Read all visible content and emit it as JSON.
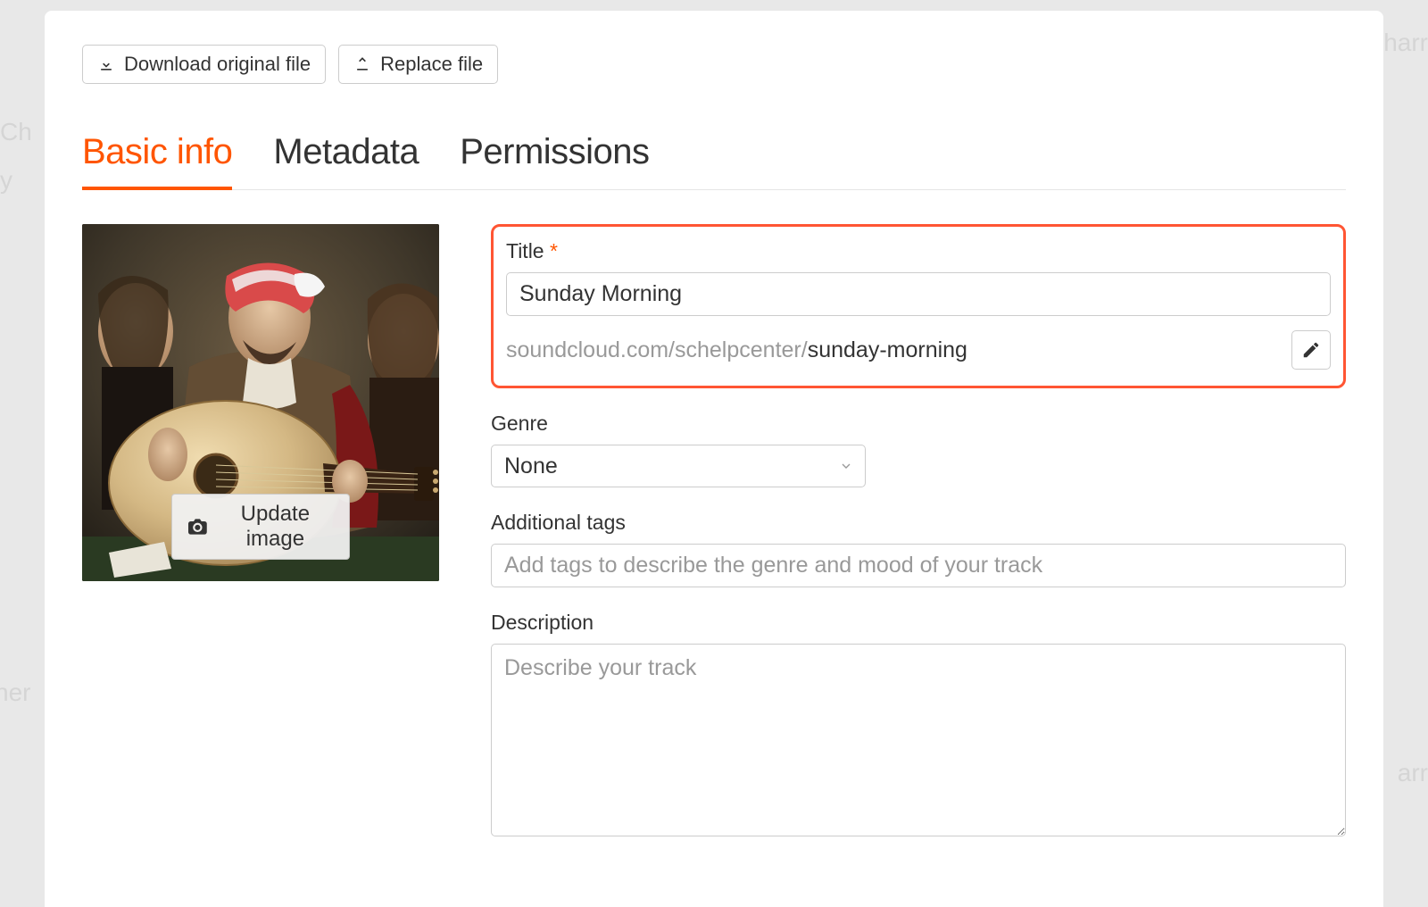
{
  "background_fragments": {
    "top_left": "Ch",
    "left": "y",
    "top_right": "harr",
    "bottom_right": "arr",
    "bottom_left": "her"
  },
  "buttons": {
    "download": "Download original file",
    "replace": "Replace file",
    "update_image": "Update image"
  },
  "tabs": {
    "basic_info": "Basic info",
    "metadata": "Metadata",
    "permissions": "Permissions"
  },
  "fields": {
    "title": {
      "label": "Title",
      "required": "*",
      "value": "Sunday Morning"
    },
    "permalink": {
      "prefix": "soundcloud.com/schelpcenter/",
      "slug": "sunday-morning"
    },
    "genre": {
      "label": "Genre",
      "value": "None"
    },
    "tags": {
      "label": "Additional tags",
      "placeholder": "Add tags to describe the genre and mood of your track"
    },
    "description": {
      "label": "Description",
      "placeholder": "Describe your track"
    }
  }
}
